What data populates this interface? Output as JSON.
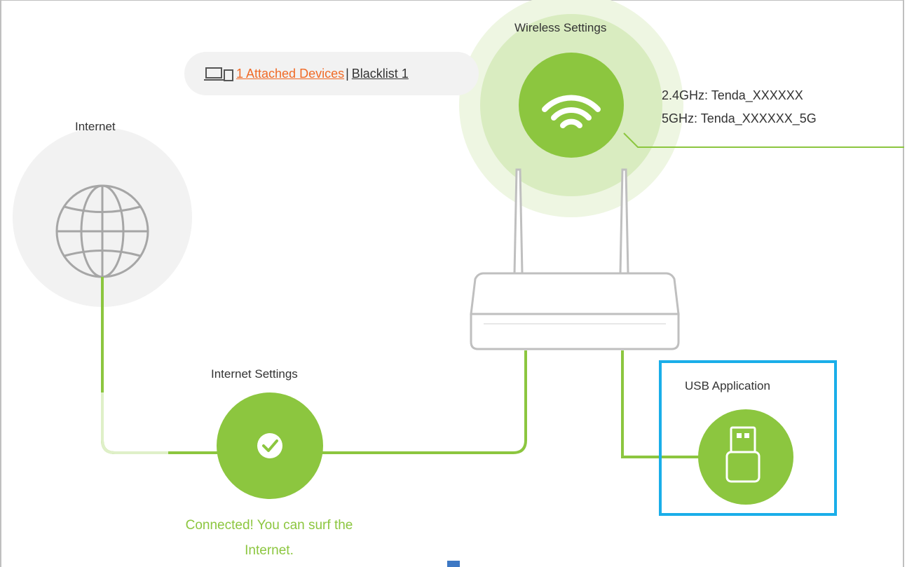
{
  "wireless": {
    "title": "Wireless Settings",
    "ssid_24": "2.4GHz: Tenda_XXXXXX",
    "ssid_5": "5GHz: Tenda_XXXXXX_5G"
  },
  "devices_bar": {
    "attached_link": "1 Attached Devices ",
    "separator": "|",
    "blacklist_link": "Blacklist 1"
  },
  "internet": {
    "title": "Internet"
  },
  "internet_settings": {
    "title": "Internet Settings",
    "status_line1": "Connected! You can surf the",
    "status_line2": "Internet."
  },
  "usb": {
    "title": "USB Application"
  },
  "colors": {
    "accent_green": "#8cc63f",
    "link_orange": "#f06a26",
    "highlight_blue": "#1aaee9",
    "gray_icon": "#a6a6a6"
  }
}
